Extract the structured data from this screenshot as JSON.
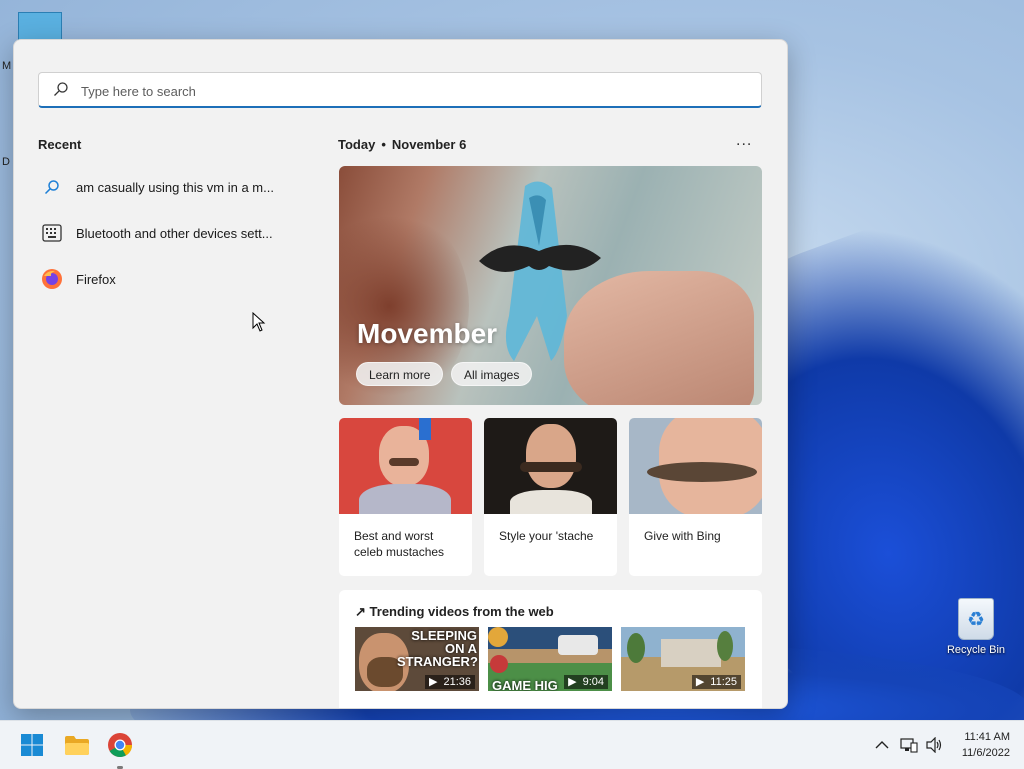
{
  "desktop": {
    "left_letters": [
      "M",
      "D"
    ],
    "recycle_bin_label": "Recycle Bin"
  },
  "search": {
    "placeholder": "Type here to search"
  },
  "recent": {
    "heading": "Recent",
    "items": [
      {
        "label": "am casually using this vm in a m...",
        "icon": "search-icon"
      },
      {
        "label": "Bluetooth and other devices sett...",
        "icon": "settings-keyboard-icon"
      },
      {
        "label": "Firefox",
        "icon": "firefox-icon"
      }
    ]
  },
  "today": {
    "label": "Today",
    "date": "November 6",
    "more": "..."
  },
  "hero": {
    "title": "Movember",
    "learn_more": "Learn more",
    "all_images": "All images"
  },
  "cards": [
    {
      "label": "Best and worst celeb mustaches"
    },
    {
      "label": "Style your 'stache"
    },
    {
      "label": "Give with Bing"
    }
  ],
  "trending": {
    "heading": "Trending videos from the web",
    "videos": [
      {
        "duration": "21:36",
        "overlay": "SLEEPING ON A STRANGER?"
      },
      {
        "duration": "9:04",
        "overlay": "GAME HIG"
      },
      {
        "duration": "11:25",
        "overlay": ""
      }
    ]
  },
  "taskbar": {
    "time": "11:41 AM",
    "date": "11/6/2022",
    "icons": [
      "start-icon",
      "file-explorer-icon",
      "chrome-icon"
    ],
    "tray": [
      "chevron-up-icon",
      "network-icon",
      "volume-icon"
    ]
  },
  "colors": {
    "accent": "#1d6fb8",
    "panel_bg": "#f2f2f2",
    "taskbar_bg": "#f0f3f7"
  }
}
